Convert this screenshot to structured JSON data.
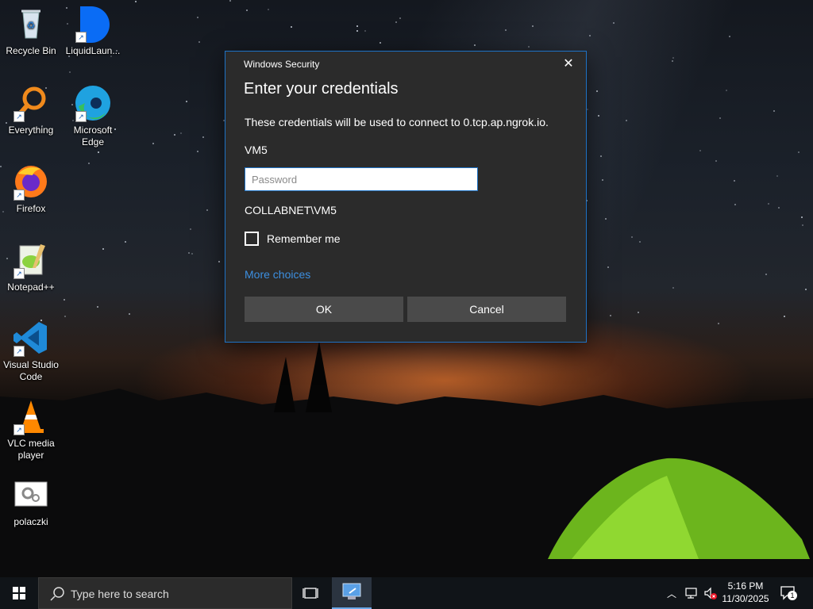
{
  "desktop": {
    "icons": [
      {
        "label": "Recycle Bin"
      },
      {
        "label": "LiquidLaun..."
      },
      {
        "label": "Everything"
      },
      {
        "label": "Microsoft Edge"
      },
      {
        "label": "Firefox"
      },
      {
        "label": "Notepad++"
      },
      {
        "label": "Visual Studio Code"
      },
      {
        "label": "VLC media player"
      },
      {
        "label": "polaczki"
      }
    ]
  },
  "dialog": {
    "caption": "Windows Security",
    "heading": "Enter your credentials",
    "description": "These credentials will be used to connect to 0.tcp.ap.ngrok.io.",
    "username": "VM5",
    "password_placeholder": "Password",
    "password_value": "",
    "domain_user": "COLLABNET\\VM5",
    "remember_label": "Remember me",
    "remember_checked": false,
    "more_choices": "More choices",
    "ok_label": "OK",
    "cancel_label": "Cancel",
    "accent_color": "#1e72c5"
  },
  "taskbar": {
    "search_placeholder": "Type here to search",
    "clock_time": "5:16 PM",
    "clock_date": "11/30/2025",
    "notification_count": "1"
  }
}
